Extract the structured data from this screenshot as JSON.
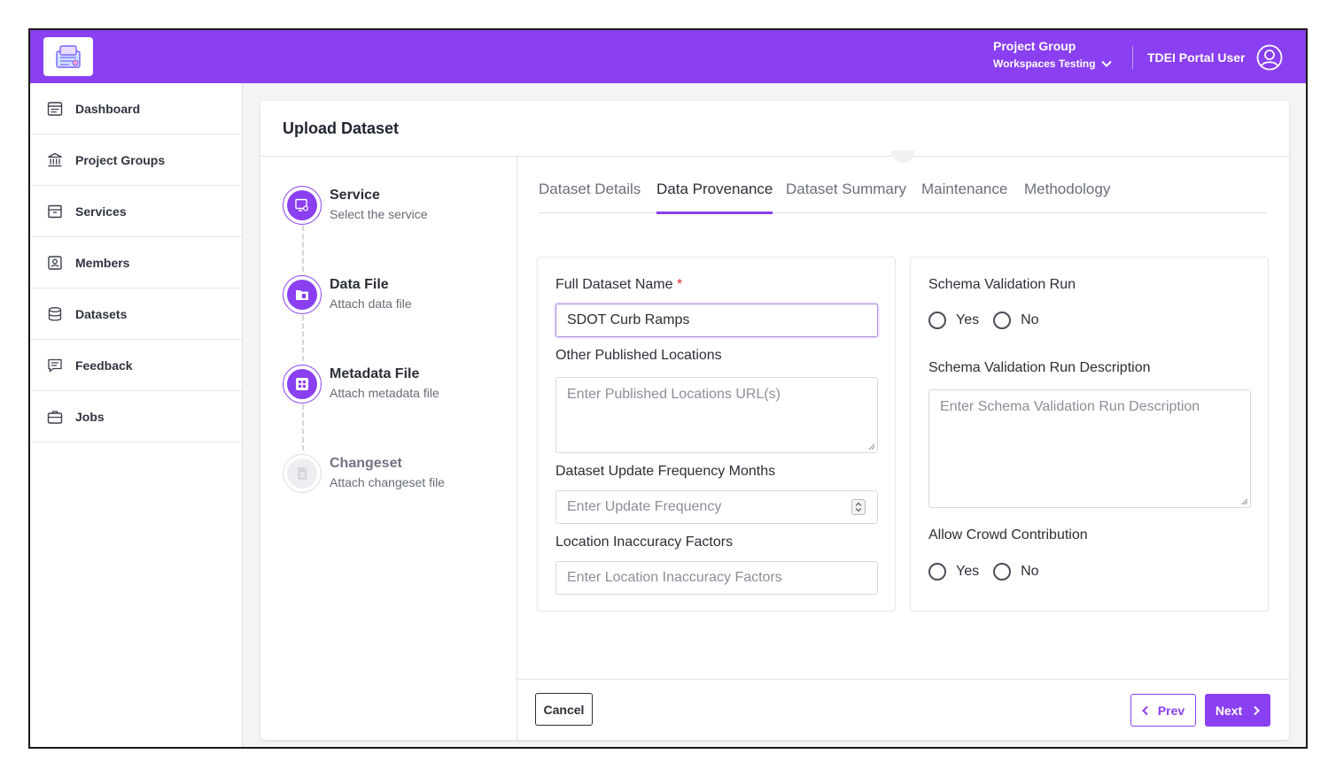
{
  "header": {
    "project_group_label": "Project Group",
    "workspace_name": "Workspaces Testing",
    "user_name": "TDEI Portal User"
  },
  "sidebar": {
    "items": [
      {
        "label": "Dashboard",
        "icon": "dashboard-icon"
      },
      {
        "label": "Project Groups",
        "icon": "bank-icon"
      },
      {
        "label": "Services",
        "icon": "archive-icon"
      },
      {
        "label": "Members",
        "icon": "member-badge-icon"
      },
      {
        "label": "Datasets",
        "icon": "database-icon"
      },
      {
        "label": "Feedback",
        "icon": "feedback-icon"
      },
      {
        "label": "Jobs",
        "icon": "briefcase-icon"
      }
    ]
  },
  "page": {
    "title": "Upload Dataset"
  },
  "steps": [
    {
      "title": "Service",
      "subtitle": "Select the service",
      "state": "complete"
    },
    {
      "title": "Data File",
      "subtitle": "Attach data file",
      "state": "complete"
    },
    {
      "title": "Metadata File",
      "subtitle": "Attach metadata file",
      "state": "active"
    },
    {
      "title": "Changeset",
      "subtitle": "Attach changeset file",
      "state": "inactive"
    }
  ],
  "tabs": [
    {
      "label": "Dataset Details",
      "active": false
    },
    {
      "label": "Data Provenance",
      "active": true
    },
    {
      "label": "Dataset Summary",
      "active": false
    },
    {
      "label": "Maintenance",
      "active": false
    },
    {
      "label": "Methodology",
      "active": false
    }
  ],
  "form_left": {
    "full_name_label": "Full Dataset Name",
    "required_mark": "*",
    "full_name_value": "SDOT Curb Ramps",
    "other_locations_label": "Other Published Locations",
    "other_locations_placeholder": "Enter Published Locations URL(s)",
    "update_freq_label": "Dataset Update Frequency Months",
    "update_freq_placeholder": "Enter Update Frequency",
    "inaccuracy_label": "Location Inaccuracy Factors",
    "inaccuracy_placeholder": "Enter Location Inaccuracy Factors"
  },
  "form_right": {
    "schema_run_label": "Schema Validation Run",
    "schema_run_options": [
      "Yes",
      "No"
    ],
    "schema_desc_label": "Schema Validation Run Description",
    "schema_desc_placeholder": "Enter Schema Validation Run Description",
    "crowd_label": "Allow Crowd Contribution",
    "crowd_options": [
      "Yes",
      "No"
    ]
  },
  "footer": {
    "cancel_label": "Cancel",
    "prev_label": "Prev",
    "next_label": "Next"
  },
  "colors": {
    "accent": "#8a3ff0",
    "required": "#e11d2e"
  }
}
